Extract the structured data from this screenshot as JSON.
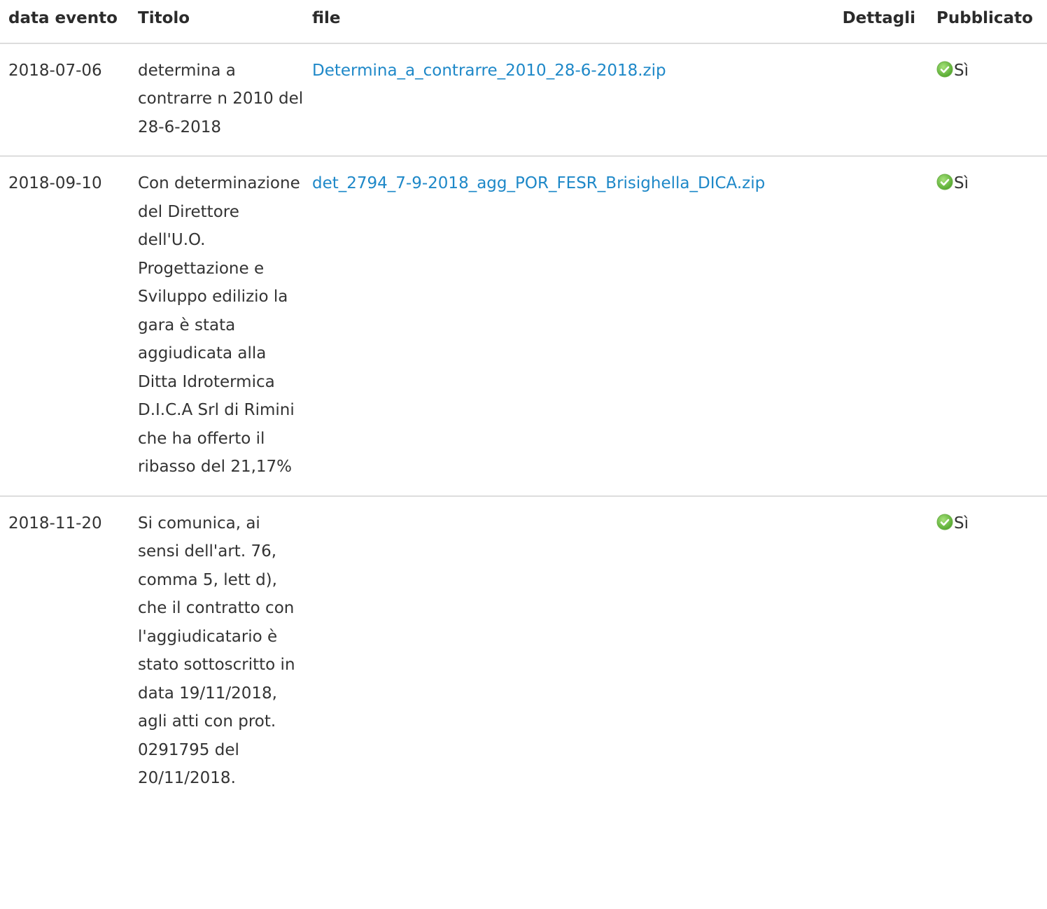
{
  "table": {
    "headers": {
      "date": "data evento",
      "title": "Titolo",
      "file": "file",
      "details": "Dettagli",
      "published": "Pubblicato"
    },
    "rows": [
      {
        "date": "2018-07-06",
        "title": "determina a contrarre n 2010 del 28-6-2018",
        "file": "Determina_a_contrarre_2010_28-6-2018.zip",
        "details": "",
        "published": "Sì",
        "published_icon": "check-circle-icon"
      },
      {
        "date": "2018-09-10",
        "title": "Con determinazione del Direttore dell'U.O. Progettazione e Sviluppo edilizio la gara è stata aggiudicata alla Ditta Idrotermica D.I.C.A Srl di Rimini che ha offerto il ribasso del 21,17%",
        "file": "det_2794_7-9-2018_agg_POR_FESR_Brisighella_DICA.zip",
        "details": "",
        "published": "Sì",
        "published_icon": "check-circle-icon"
      },
      {
        "date": "2018-11-20",
        "title": "Si comunica, ai sensi dell'art. 76, comma 5, lett d), che il contratto con l'aggiudicatario è stato sottoscritto in data 19/11/2018, agli atti con prot. 0291795 del 20/11/2018.",
        "file": "",
        "details": "",
        "published": "Sì",
        "published_icon": "check-circle-icon"
      }
    ]
  },
  "colors": {
    "link": "#1e88c8",
    "text": "#333333",
    "border": "#dddddd",
    "icon_green": "#6cbf3c"
  }
}
